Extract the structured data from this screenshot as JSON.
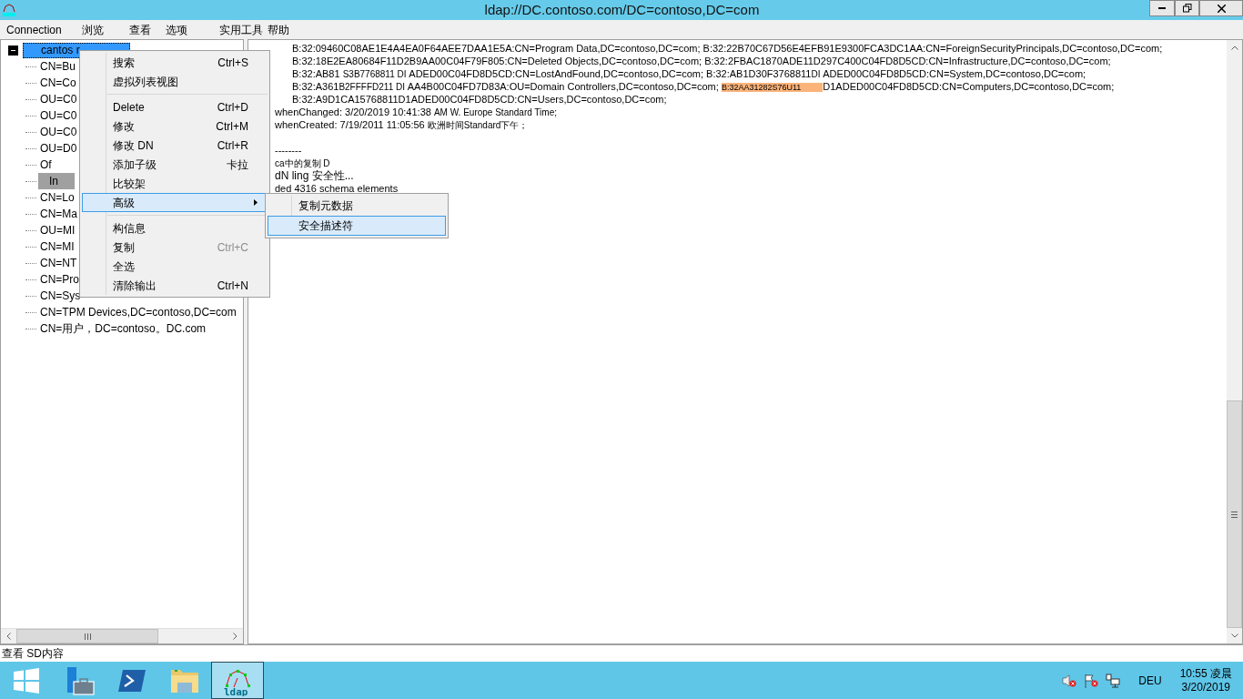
{
  "window": {
    "title": "ldap://DC.contoso.com/DC=contoso,DC=com"
  },
  "menu_bar": [
    "Connection",
    "浏览",
    "查看",
    "选项",
    "实用工具",
    "帮助"
  ],
  "tree": {
    "label": "cantos r",
    "selected": true,
    "expanded": true,
    "children": [
      {
        "label": "CN=Bu",
        "marked": false
      },
      {
        "label": "CN=Co",
        "marked": false
      },
      {
        "label": "OU=C0",
        "marked": false
      },
      {
        "label": "OU=C0",
        "marked": false
      },
      {
        "label": "OU=C0",
        "marked": false
      },
      {
        "label": "OU=D0",
        "marked": false
      },
      {
        "label": "Of",
        "marked": false
      },
      {
        "label": "In",
        "marked": true
      },
      {
        "label": "CN=Lo",
        "marked": false
      },
      {
        "label": "CN=Ma",
        "marked": false
      },
      {
        "label": "OU=MI",
        "marked": false
      },
      {
        "label": "CN=MI",
        "marked": false
      },
      {
        "label": "CN=NT",
        "marked": false
      },
      {
        "label": "CN=Pro",
        "marked": false
      },
      {
        "label": "CN=Sys",
        "marked": false
      },
      {
        "label": "CN=TPM Devices,DC=contoso,DC=com",
        "marked": false
      },
      {
        "label": "CN=用户，DC=contoso。DC.com",
        "marked": false
      }
    ]
  },
  "output": [
    {
      "kind": "value",
      "segments": [
        {
          "kind": "normal",
          "text": "B:32:09460C08AE1E4A4EA0F64AEE7DAA1E5A:CN=Program Data,DC=contoso,DC=com; B:32:22B70C67D56E4EFB91E9300FCA3DC1AA:CN=ForeignSecurityPrincipals,DC=contoso,DC=com;"
        }
      ]
    },
    {
      "kind": "value",
      "segments": [
        {
          "kind": "normal",
          "text": "B:32:18E2EA80684F11D2B9AA00C04F79F805:CN=Deleted Objects,DC=contoso,DC=com; B:32:2FBAC1870ADE11D297C400C04FD8D5CD:CN=Infrastructure,DC=contoso,DC=com;"
        }
      ]
    },
    {
      "kind": "value",
      "segments": [
        {
          "kind": "normal",
          "text": "B:32:AB81 "
        },
        {
          "kind": "small",
          "text": "S3B7768811 DI "
        },
        {
          "kind": "normal",
          "text": "ADED00C04FD8D5CD:CN=LostAndFound,DC=contoso,DC=com; B:32:AB1D30F3768811"
        },
        {
          "kind": "small",
          "text": "DI "
        },
        {
          "kind": "normal",
          "text": "ADED00C04FD8D5CD:CN=System,DC=contoso,DC=com;"
        }
      ]
    },
    {
      "kind": "value",
      "segments": [
        {
          "kind": "normal",
          "text": "B:32:A361"
        },
        {
          "kind": "small",
          "text": "B2FFFFD211 DI "
        },
        {
          "kind": "normal",
          "text": "AA4B00C04FD7D83A:OU=Domain Controllers,DC=contoso,DC=com; "
        },
        {
          "kind": "marked",
          "text": "B:32AA31282S76U11"
        },
        {
          "kind": "normal",
          "text": "D1ADED00C04FD8D5CD:CN=Computers,DC=contoso,DC=com;"
        }
      ]
    },
    {
      "kind": "value",
      "segments": [
        {
          "kind": "normal",
          "text": "B:32:A9D1CA15768811D1ADED00C04FD8D5CD:CN=Users,DC=contoso,DC=com;"
        }
      ]
    },
    {
      "kind": "attr",
      "segments": [
        {
          "kind": "normal",
          "text": "whenChanged: 3/20/2019 10:41:38 "
        },
        {
          "kind": "small",
          "text": "AM W. Europe Standard Time;"
        }
      ]
    },
    {
      "kind": "attr",
      "segments": [
        {
          "kind": "normal",
          "text": "whenCreated: 7/19/2011 11:05:56 "
        },
        {
          "kind": "small",
          "text": "欧洲时间Standard下午；"
        }
      ]
    },
    {
      "kind": "rule",
      "segments": [
        {
          "kind": "normal",
          "text": "--------"
        }
      ]
    },
    {
      "kind": "log",
      "segments": [
        {
          "kind": "small",
          "text": "ca中的复制 D"
        }
      ]
    },
    {
      "kind": "log",
      "segments": [
        {
          "kind": "large",
          "text": "dN ling 安全性..."
        }
      ]
    },
    {
      "kind": "log",
      "segments": [
        {
          "kind": "normal",
          "text": "ded 4316 schema elements"
        }
      ]
    }
  ],
  "context_menu": [
    {
      "kind": "item",
      "label": "搜索",
      "shortcut": "Ctrl+S",
      "highlighted": false,
      "submenu": false,
      "shortcut_disabled": false
    },
    {
      "kind": "item",
      "label": "虚拟列表视图",
      "highlighted": false,
      "submenu": false
    },
    {
      "kind": "separator"
    },
    {
      "kind": "item",
      "label": "Delete",
      "shortcut": "Ctrl+D",
      "highlighted": false,
      "submenu": false,
      "shortcut_disabled": false
    },
    {
      "kind": "item",
      "label": "修改",
      "shortcut": "Ctrl+M",
      "highlighted": false,
      "submenu": false,
      "shortcut_disabled": false
    },
    {
      "kind": "item",
      "label": "修改 DN",
      "shortcut": "Ctrl+R",
      "highlighted": false,
      "submenu": false,
      "shortcut_disabled": false
    },
    {
      "kind": "item",
      "label": "添加子级",
      "shortcut": "卡拉",
      "highlighted": false,
      "submenu": false,
      "shortcut_disabled": false
    },
    {
      "kind": "item",
      "label": "比较架",
      "highlighted": false,
      "submenu": false
    },
    {
      "kind": "item",
      "label": "高级",
      "highlighted": true,
      "submenu": true
    },
    {
      "kind": "separator"
    },
    {
      "kind": "item",
      "label": "构信息",
      "highlighted": false,
      "submenu": false
    },
    {
      "kind": "item",
      "label": "复制",
      "shortcut": "Ctrl+C",
      "highlighted": false,
      "submenu": false,
      "shortcut_disabled": true
    },
    {
      "kind": "item",
      "label": "全选",
      "highlighted": false,
      "submenu": false
    },
    {
      "kind": "item",
      "label": "清除输出",
      "shortcut": "Ctrl+N",
      "highlighted": false,
      "submenu": false,
      "shortcut_disabled": false
    }
  ],
  "submenu": [
    {
      "label": "复制元数据",
      "highlighted": false
    },
    {
      "label": "安全描述符",
      "highlighted": true
    }
  ],
  "status_bar": "查看 SD内容",
  "taskbar": {
    "apps": [
      {
        "kind": "start",
        "active": false
      },
      {
        "kind": "server",
        "active": false
      },
      {
        "kind": "shell",
        "active": false
      },
      {
        "kind": "folder",
        "active": false
      },
      {
        "kind": "ldp",
        "active": true,
        "label": "ldap"
      }
    ],
    "language": "DEU",
    "time": "10:55 凌晨",
    "date": "3/20/2019"
  }
}
